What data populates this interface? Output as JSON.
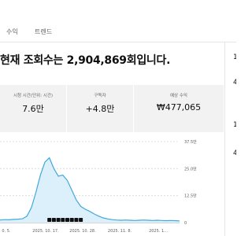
{
  "tabs": [
    {
      "label": "수익"
    },
    {
      "label": "트렌드"
    }
  ],
  "headline": "현재 조회수는 2,904,869회입니다.",
  "metrics": [
    {
      "label": "시청 시간(단위: 시간)",
      "value": "7.6만"
    },
    {
      "label": "구독자",
      "value": "+4.8만"
    },
    {
      "label": "예상 수익",
      "value": "₩477,065"
    }
  ],
  "chart_data": {
    "type": "area",
    "x_labels": [
      "0. 5.",
      "2025. 10. 17.",
      "2025. 10. 28.",
      "2025. 11. 8.",
      "2025. 1..."
    ],
    "y_ticks": [
      "37.5만",
      "25.0만",
      "12.5만",
      "0"
    ],
    "ylim": [
      0,
      375000
    ],
    "values": [
      12000,
      14000,
      13000,
      15000,
      16000,
      18000,
      30000,
      70000,
      140000,
      220000,
      280000,
      300000,
      250000,
      215000,
      220000,
      195000,
      150000,
      105000,
      75000,
      62000,
      52000,
      40000,
      30000,
      22000,
      17000,
      14000,
      12000,
      11000,
      12000,
      11000,
      10000,
      11000,
      12000,
      11000,
      10000,
      11000,
      10000,
      9000,
      10000,
      9000,
      8000
    ],
    "grid": true,
    "line_color": "#41a8db",
    "fill_color": "#dcf0fb"
  },
  "side": {
    "items": [
      "1",
      "4",
      "1",
      "4"
    ]
  }
}
